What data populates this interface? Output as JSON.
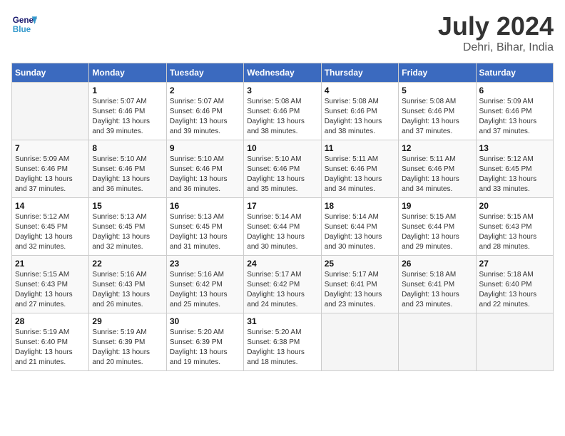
{
  "header": {
    "logo_line1": "General",
    "logo_line2": "Blue",
    "month_year": "July 2024",
    "location": "Dehri, Bihar, India"
  },
  "days_of_week": [
    "Sunday",
    "Monday",
    "Tuesday",
    "Wednesday",
    "Thursday",
    "Friday",
    "Saturday"
  ],
  "weeks": [
    [
      {
        "day": "",
        "info": ""
      },
      {
        "day": "1",
        "info": "Sunrise: 5:07 AM\nSunset: 6:46 PM\nDaylight: 13 hours\nand 39 minutes."
      },
      {
        "day": "2",
        "info": "Sunrise: 5:07 AM\nSunset: 6:46 PM\nDaylight: 13 hours\nand 39 minutes."
      },
      {
        "day": "3",
        "info": "Sunrise: 5:08 AM\nSunset: 6:46 PM\nDaylight: 13 hours\nand 38 minutes."
      },
      {
        "day": "4",
        "info": "Sunrise: 5:08 AM\nSunset: 6:46 PM\nDaylight: 13 hours\nand 38 minutes."
      },
      {
        "day": "5",
        "info": "Sunrise: 5:08 AM\nSunset: 6:46 PM\nDaylight: 13 hours\nand 37 minutes."
      },
      {
        "day": "6",
        "info": "Sunrise: 5:09 AM\nSunset: 6:46 PM\nDaylight: 13 hours\nand 37 minutes."
      }
    ],
    [
      {
        "day": "7",
        "info": "Sunrise: 5:09 AM\nSunset: 6:46 PM\nDaylight: 13 hours\nand 37 minutes."
      },
      {
        "day": "8",
        "info": "Sunrise: 5:10 AM\nSunset: 6:46 PM\nDaylight: 13 hours\nand 36 minutes."
      },
      {
        "day": "9",
        "info": "Sunrise: 5:10 AM\nSunset: 6:46 PM\nDaylight: 13 hours\nand 36 minutes."
      },
      {
        "day": "10",
        "info": "Sunrise: 5:10 AM\nSunset: 6:46 PM\nDaylight: 13 hours\nand 35 minutes."
      },
      {
        "day": "11",
        "info": "Sunrise: 5:11 AM\nSunset: 6:46 PM\nDaylight: 13 hours\nand 34 minutes."
      },
      {
        "day": "12",
        "info": "Sunrise: 5:11 AM\nSunset: 6:46 PM\nDaylight: 13 hours\nand 34 minutes."
      },
      {
        "day": "13",
        "info": "Sunrise: 5:12 AM\nSunset: 6:45 PM\nDaylight: 13 hours\nand 33 minutes."
      }
    ],
    [
      {
        "day": "14",
        "info": "Sunrise: 5:12 AM\nSunset: 6:45 PM\nDaylight: 13 hours\nand 32 minutes."
      },
      {
        "day": "15",
        "info": "Sunrise: 5:13 AM\nSunset: 6:45 PM\nDaylight: 13 hours\nand 32 minutes."
      },
      {
        "day": "16",
        "info": "Sunrise: 5:13 AM\nSunset: 6:45 PM\nDaylight: 13 hours\nand 31 minutes."
      },
      {
        "day": "17",
        "info": "Sunrise: 5:14 AM\nSunset: 6:44 PM\nDaylight: 13 hours\nand 30 minutes."
      },
      {
        "day": "18",
        "info": "Sunrise: 5:14 AM\nSunset: 6:44 PM\nDaylight: 13 hours\nand 30 minutes."
      },
      {
        "day": "19",
        "info": "Sunrise: 5:15 AM\nSunset: 6:44 PM\nDaylight: 13 hours\nand 29 minutes."
      },
      {
        "day": "20",
        "info": "Sunrise: 5:15 AM\nSunset: 6:43 PM\nDaylight: 13 hours\nand 28 minutes."
      }
    ],
    [
      {
        "day": "21",
        "info": "Sunrise: 5:15 AM\nSunset: 6:43 PM\nDaylight: 13 hours\nand 27 minutes."
      },
      {
        "day": "22",
        "info": "Sunrise: 5:16 AM\nSunset: 6:43 PM\nDaylight: 13 hours\nand 26 minutes."
      },
      {
        "day": "23",
        "info": "Sunrise: 5:16 AM\nSunset: 6:42 PM\nDaylight: 13 hours\nand 25 minutes."
      },
      {
        "day": "24",
        "info": "Sunrise: 5:17 AM\nSunset: 6:42 PM\nDaylight: 13 hours\nand 24 minutes."
      },
      {
        "day": "25",
        "info": "Sunrise: 5:17 AM\nSunset: 6:41 PM\nDaylight: 13 hours\nand 23 minutes."
      },
      {
        "day": "26",
        "info": "Sunrise: 5:18 AM\nSunset: 6:41 PM\nDaylight: 13 hours\nand 23 minutes."
      },
      {
        "day": "27",
        "info": "Sunrise: 5:18 AM\nSunset: 6:40 PM\nDaylight: 13 hours\nand 22 minutes."
      }
    ],
    [
      {
        "day": "28",
        "info": "Sunrise: 5:19 AM\nSunset: 6:40 PM\nDaylight: 13 hours\nand 21 minutes."
      },
      {
        "day": "29",
        "info": "Sunrise: 5:19 AM\nSunset: 6:39 PM\nDaylight: 13 hours\nand 20 minutes."
      },
      {
        "day": "30",
        "info": "Sunrise: 5:20 AM\nSunset: 6:39 PM\nDaylight: 13 hours\nand 19 minutes."
      },
      {
        "day": "31",
        "info": "Sunrise: 5:20 AM\nSunset: 6:38 PM\nDaylight: 13 hours\nand 18 minutes."
      },
      {
        "day": "",
        "info": ""
      },
      {
        "day": "",
        "info": ""
      },
      {
        "day": "",
        "info": ""
      }
    ]
  ]
}
